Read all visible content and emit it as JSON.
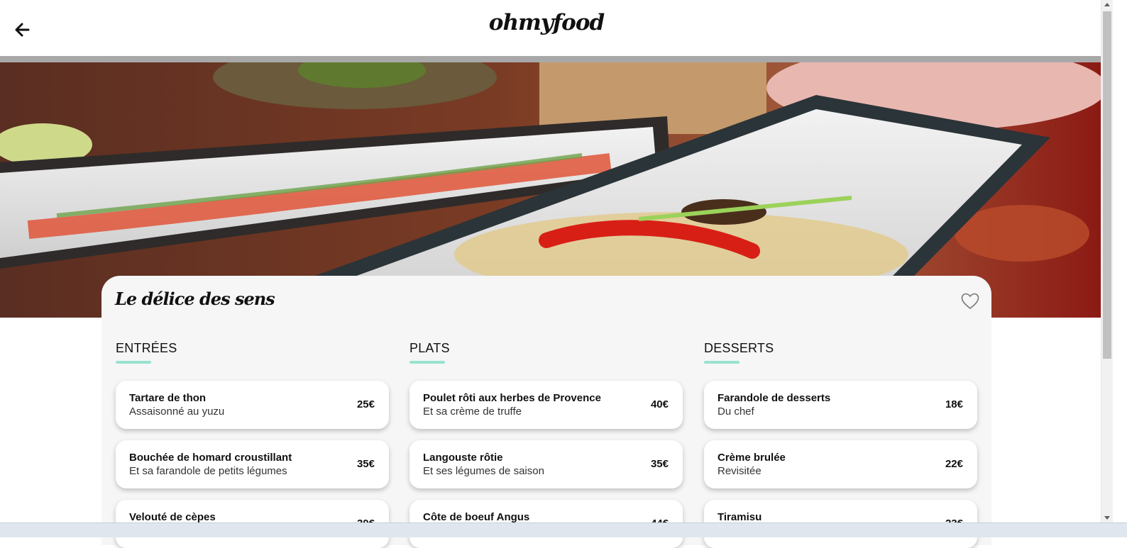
{
  "header": {
    "logo": "ohmyfood",
    "back_icon": "arrow-left-icon"
  },
  "restaurant": {
    "name": "Le délice des sens",
    "favorite_icon": "heart-outline-icon"
  },
  "colors": {
    "accent": "#99e2d0",
    "card_background": "#f6f6f6"
  },
  "menu": {
    "columns": [
      {
        "title": "ENTRÉES",
        "dishes": [
          {
            "name": "Tartare de thon",
            "desc": "Assaisonné au yuzu",
            "price": "25€"
          },
          {
            "name": "Bouchée de homard croustillant",
            "desc": "Et sa farandole de petits légumes",
            "price": "35€"
          },
          {
            "name": "Velouté de cèpes",
            "desc": "",
            "price": "30€"
          }
        ]
      },
      {
        "title": "PLATS",
        "dishes": [
          {
            "name": "Poulet rôti aux herbes de Provence",
            "desc": "Et sa crème de truffe",
            "price": "40€"
          },
          {
            "name": "Langouste rôtie",
            "desc": "Et ses légumes de saison",
            "price": "35€"
          },
          {
            "name": "Côte de boeuf Angus",
            "desc": "",
            "price": "44€"
          }
        ]
      },
      {
        "title": "DESSERTS",
        "dishes": [
          {
            "name": "Farandole de desserts",
            "desc": "Du chef",
            "price": "18€"
          },
          {
            "name": "Crème brulée",
            "desc": "Revisitée",
            "price": "22€"
          },
          {
            "name": "Tiramisu",
            "desc": "",
            "price": "23€"
          }
        ]
      }
    ]
  }
}
